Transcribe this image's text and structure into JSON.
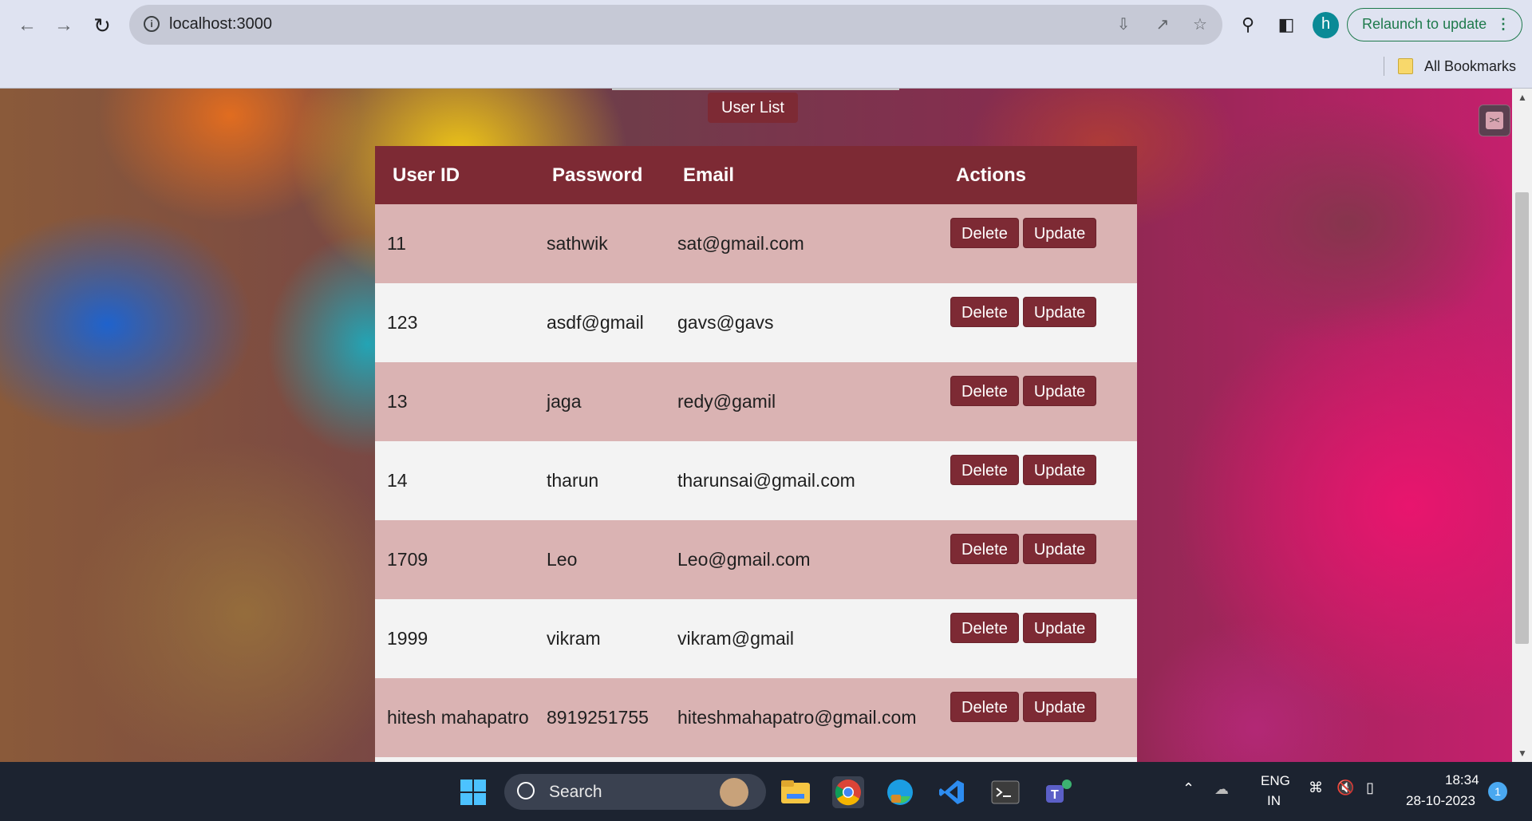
{
  "browser": {
    "url": "localhost:3000",
    "relaunch_label": "Relaunch to update",
    "profile_initial": "h",
    "bookmarks_label": "All Bookmarks"
  },
  "page": {
    "title": "User List",
    "columns": [
      "User ID",
      "Password",
      "Email",
      "Actions"
    ],
    "rows": [
      {
        "id": "11",
        "password": "sathwik",
        "email": "sat@gmail.com"
      },
      {
        "id": "123",
        "password": "asdf@gmail",
        "email": "gavs@gavs"
      },
      {
        "id": "13",
        "password": "jaga",
        "email": "redy@gamil"
      },
      {
        "id": "14",
        "password": "tharun",
        "email": "tharunsai@gmail.com"
      },
      {
        "id": "1709",
        "password": "Leo",
        "email": "Leo@gmail.com"
      },
      {
        "id": "1999",
        "password": "vikram",
        "email": "vikram@gmail"
      },
      {
        "id": "hitesh mahapatro",
        "password": "8919251755",
        "email": "hiteshmahapatro@gmail.com"
      }
    ],
    "delete_label": "Delete",
    "update_label": "Update"
  },
  "colors": {
    "accent": "#7d2a34",
    "row_odd": "#dab3b3",
    "row_even": "#f3f3f3",
    "relaunch": "#1e7a4c"
  },
  "taskbar": {
    "search_label": "Search",
    "lang_line1": "ENG",
    "lang_line2": "IN",
    "time": "18:34",
    "date": "28-10-2023",
    "notification_count": "1"
  }
}
